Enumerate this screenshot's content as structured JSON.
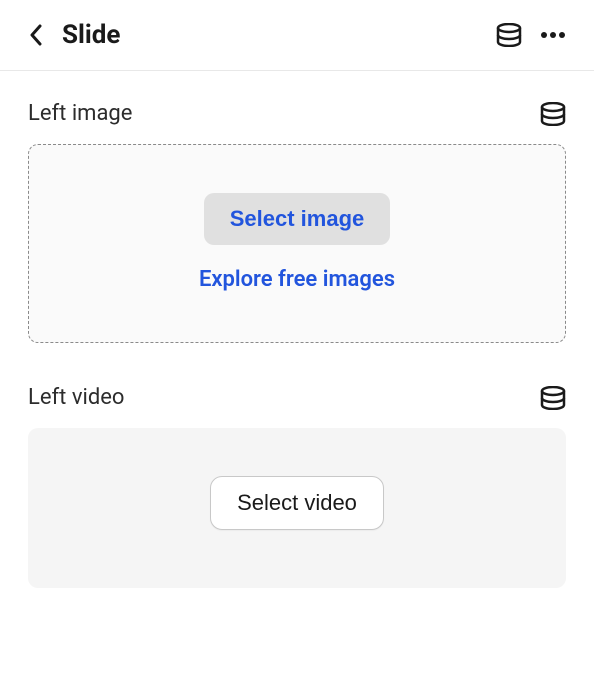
{
  "header": {
    "title": "Slide"
  },
  "sections": {
    "image": {
      "label": "Left image",
      "select_button": "Select image",
      "explore_link": "Explore free images"
    },
    "video": {
      "label": "Left video",
      "select_button": "Select video"
    }
  }
}
